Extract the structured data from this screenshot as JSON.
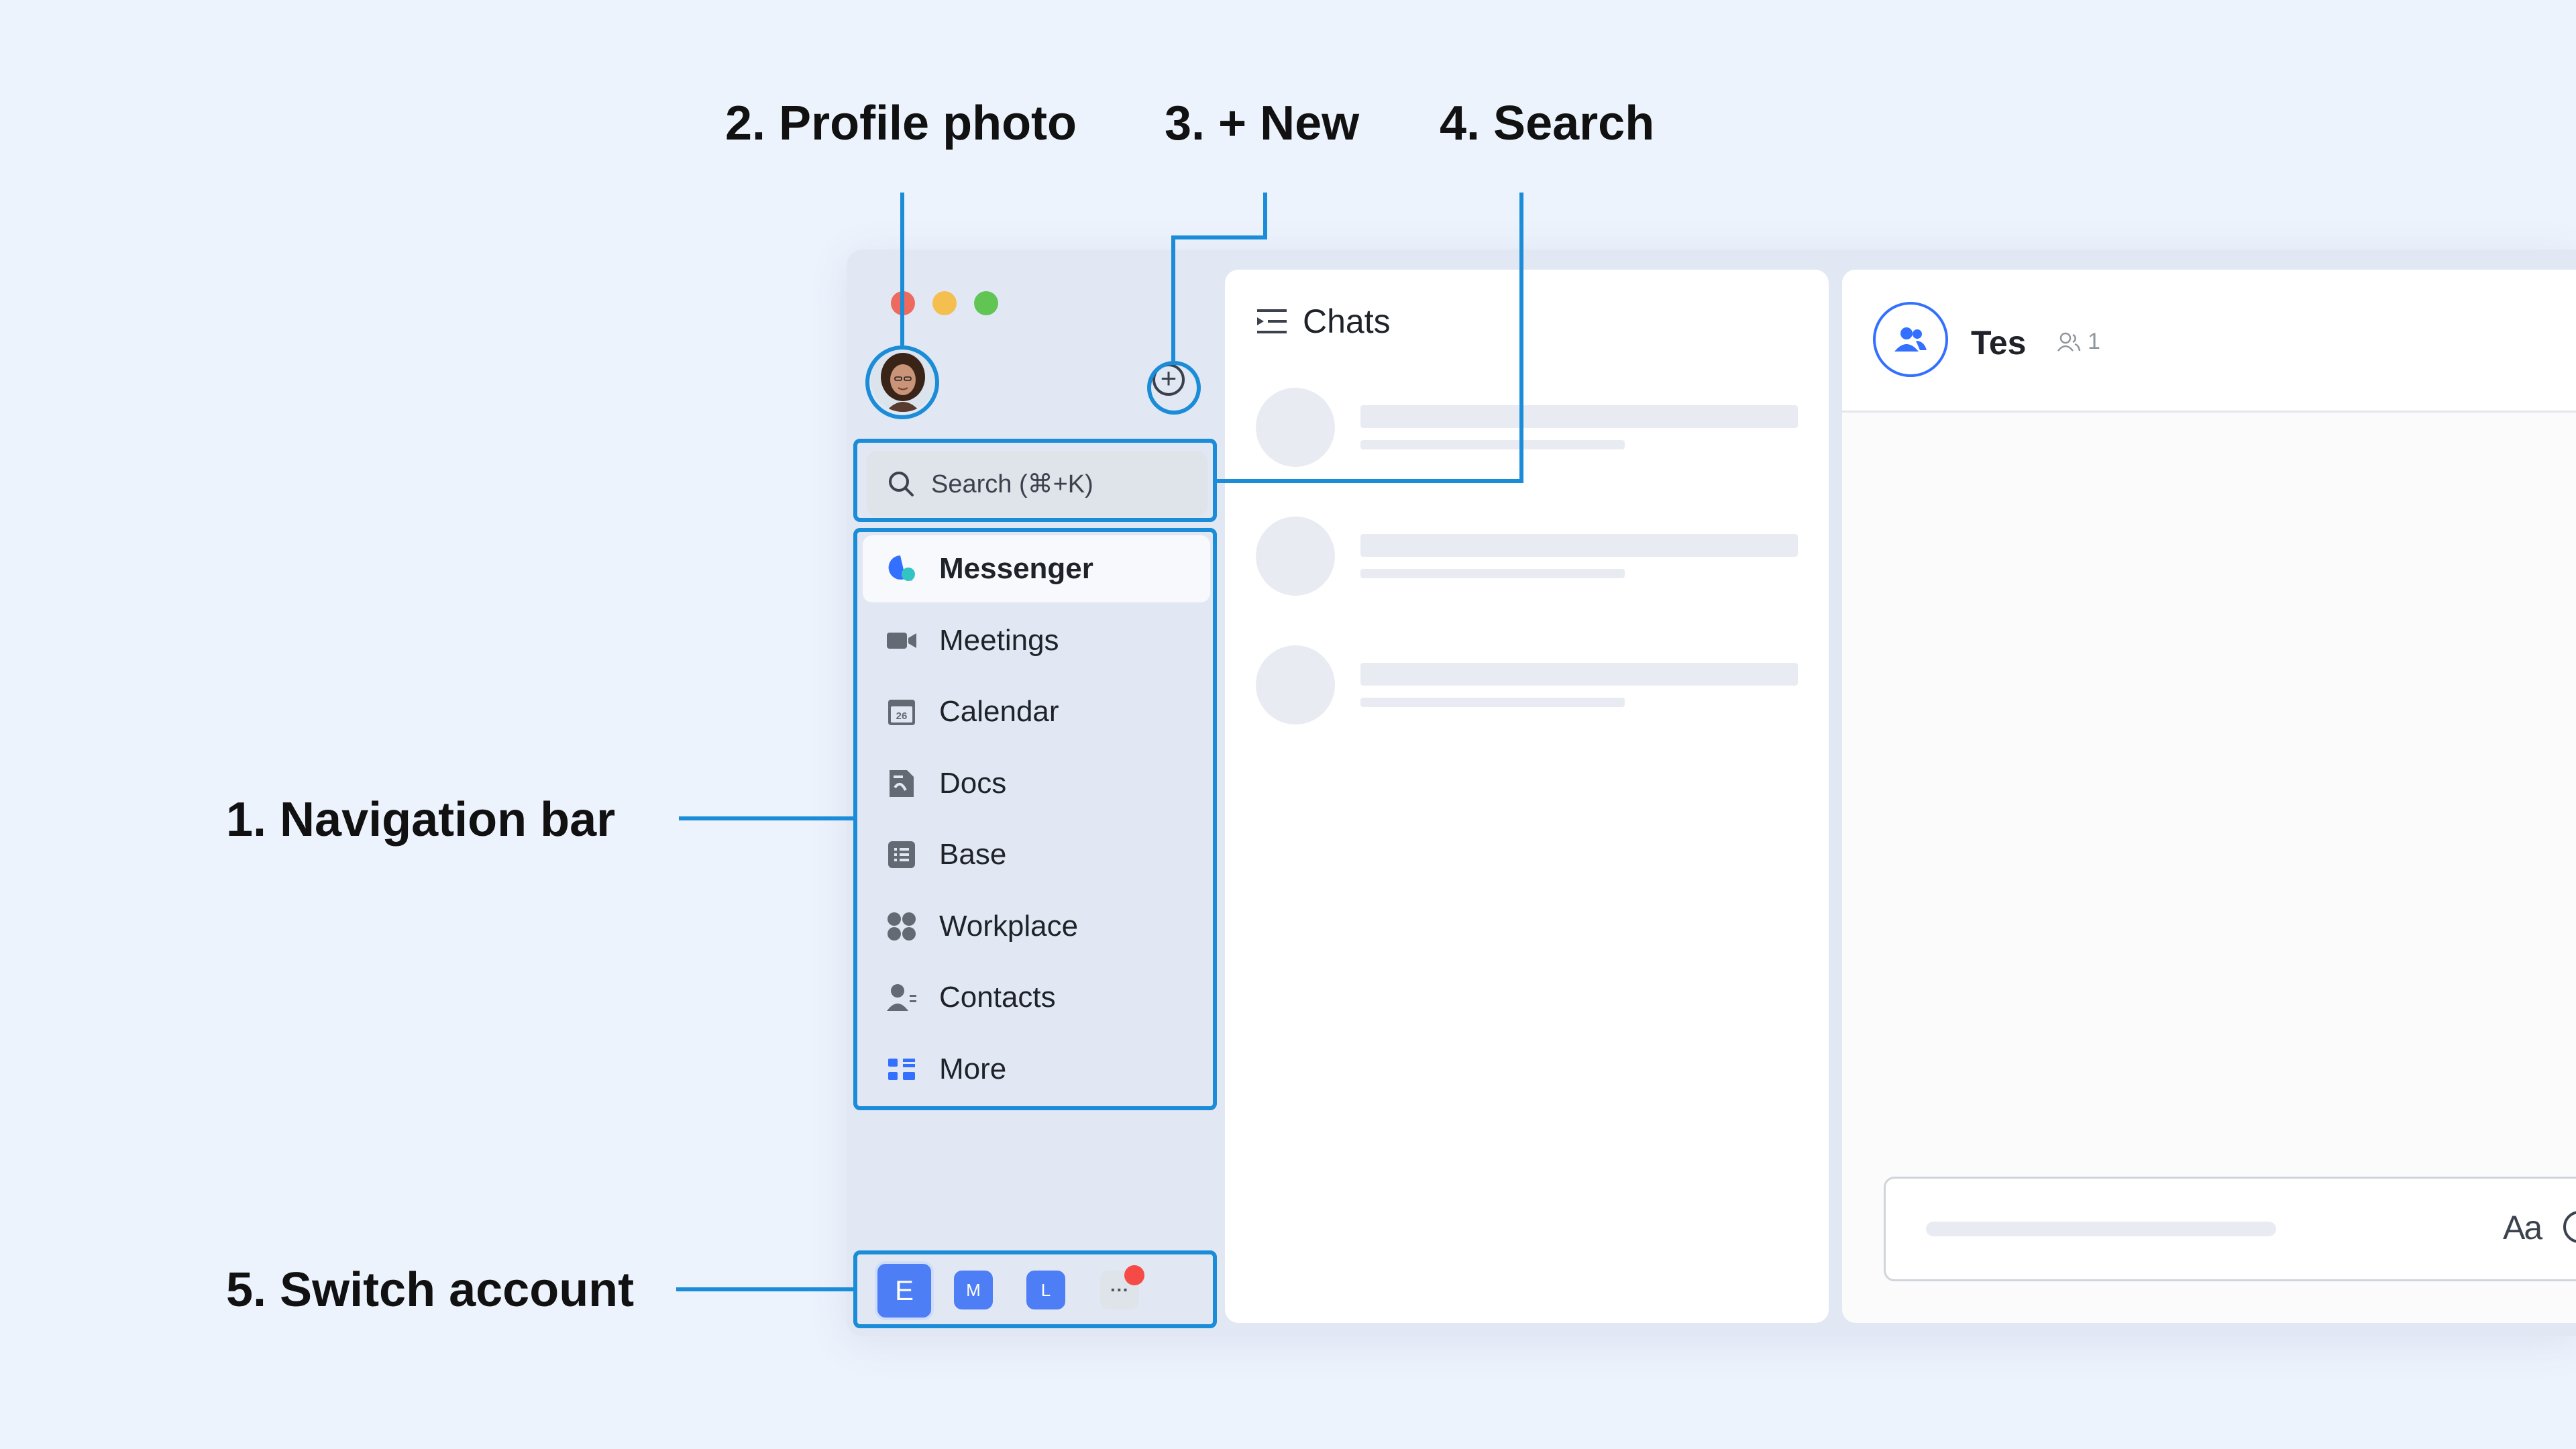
{
  "callouts": {
    "navigation_bar": "1. Navigation bar",
    "profile_photo": "2. Profile photo",
    "new": "3. + New",
    "search": "4. Search",
    "switch_account": "5. Switch account"
  },
  "sidebar": {
    "search_placeholder": "Search (⌘+K)",
    "nav_items": [
      {
        "label": "Messenger",
        "icon": "messenger-icon",
        "active": true
      },
      {
        "label": "Meetings",
        "icon": "video-camera-icon"
      },
      {
        "label": "Calendar",
        "icon": "calendar-icon",
        "badge": "26"
      },
      {
        "label": "Docs",
        "icon": "docs-icon"
      },
      {
        "label": "Base",
        "icon": "base-icon"
      },
      {
        "label": "Workplace",
        "icon": "workplace-icon"
      },
      {
        "label": "Contacts",
        "icon": "contacts-icon"
      },
      {
        "label": "More",
        "icon": "more-apps-icon"
      }
    ],
    "accounts": [
      {
        "label": "E",
        "color": "#4d7ef5"
      },
      {
        "label": "M",
        "color": "#4d7ef5"
      },
      {
        "label": "L",
        "color": "#4d7ef5"
      },
      {
        "label": "···",
        "color": "#dfe3ea"
      }
    ]
  },
  "chats_panel": {
    "title": "Chats"
  },
  "chat": {
    "name": "Tes",
    "member_count": "1",
    "format_label": "Aa"
  },
  "colors": {
    "accent": "#3370ff",
    "callout_line": "#1a8cd8",
    "notification": "#f54a45"
  }
}
